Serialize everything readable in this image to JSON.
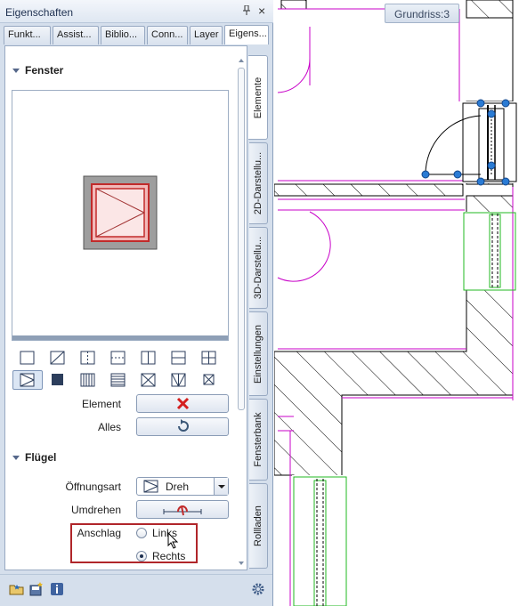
{
  "panel": {
    "title": "Eigenschaften",
    "pin_glyph": "ᵖ",
    "close_glyph": "×",
    "tabs": [
      "Funkt...",
      "Assist...",
      "Biblio...",
      "Conn...",
      "Layer",
      "Eigens..."
    ],
    "active_tab": "Eigens...",
    "side_tabs": [
      "Elemente",
      "2D-Darstellu...",
      "3D-Darstellu...",
      "Einstellungen",
      "Fensterbank",
      "Rollladen"
    ],
    "active_side_tab": "Elemente"
  },
  "fenster": {
    "heading": "Fenster",
    "element_label": "Element",
    "alles_label": "Alles"
  },
  "fluegel": {
    "heading": "Flügel",
    "oeffnungsart_label": "Öffnungsart",
    "oeffnungsart_value": "Dreh",
    "umdrehen_label": "Umdrehen",
    "anschlag_label": "Anschlag",
    "options": [
      {
        "label": "Links",
        "selected": false
      },
      {
        "label": "Rechts",
        "selected": true
      }
    ]
  },
  "canvas": {
    "view_label": "Grundriss:3"
  },
  "colors": {
    "panel_bg": "#d5dfec",
    "accent_red": "#b0262a",
    "wall_magenta": "#c800c8",
    "window_green": "#22b822",
    "handle_blue": "#2a7bd4"
  }
}
